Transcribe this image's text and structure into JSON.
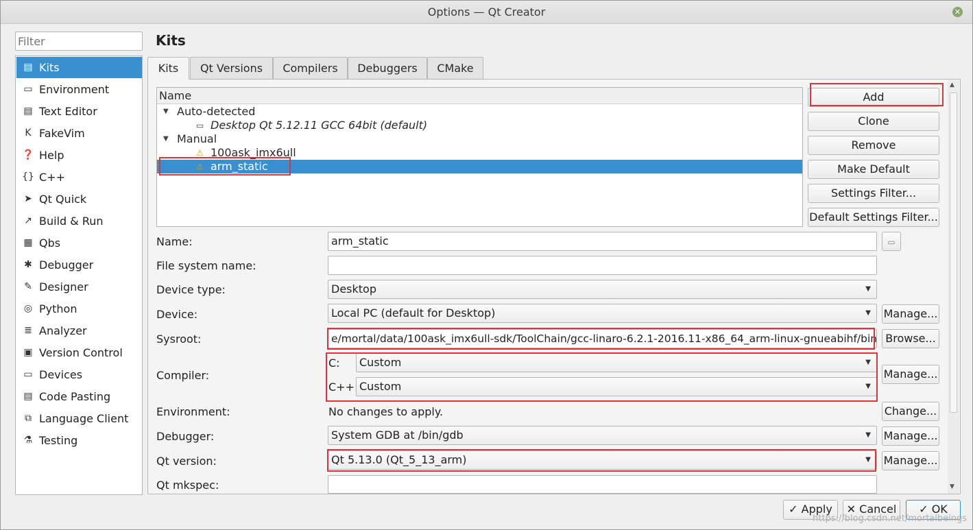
{
  "window": {
    "title": "Options — Qt Creator"
  },
  "filter": {
    "placeholder": "Filter"
  },
  "sidebar": {
    "items": [
      {
        "label": "Kits",
        "icon": "kits-icon",
        "glyph": "▤",
        "selected": true
      },
      {
        "label": "Environment",
        "icon": "environment-icon",
        "glyph": "▭"
      },
      {
        "label": "Text Editor",
        "icon": "text-editor-icon",
        "glyph": "▤"
      },
      {
        "label": "FakeVim",
        "icon": "fakevim-icon",
        "glyph": "K"
      },
      {
        "label": "Help",
        "icon": "help-icon",
        "glyph": "❓"
      },
      {
        "label": "C++",
        "icon": "cpp-icon",
        "glyph": "{}"
      },
      {
        "label": "Qt Quick",
        "icon": "qt-quick-icon",
        "glyph": "➤"
      },
      {
        "label": "Build & Run",
        "icon": "build-run-icon",
        "glyph": "↗"
      },
      {
        "label": "Qbs",
        "icon": "qbs-icon",
        "glyph": "▦"
      },
      {
        "label": "Debugger",
        "icon": "debugger-icon",
        "glyph": "✱"
      },
      {
        "label": "Designer",
        "icon": "designer-icon",
        "glyph": "✎"
      },
      {
        "label": "Python",
        "icon": "python-icon",
        "glyph": "◎"
      },
      {
        "label": "Analyzer",
        "icon": "analyzer-icon",
        "glyph": "≣"
      },
      {
        "label": "Version Control",
        "icon": "version-control-icon",
        "glyph": "▣"
      },
      {
        "label": "Devices",
        "icon": "devices-icon",
        "glyph": "▭"
      },
      {
        "label": "Code Pasting",
        "icon": "code-pasting-icon",
        "glyph": "▤"
      },
      {
        "label": "Language Client",
        "icon": "language-client-icon",
        "glyph": "⧉"
      },
      {
        "label": "Testing",
        "icon": "testing-icon",
        "glyph": "⚗"
      }
    ]
  },
  "page": {
    "title": "Kits"
  },
  "tabs": [
    {
      "label": "Kits",
      "active": true
    },
    {
      "label": "Qt Versions"
    },
    {
      "label": "Compilers"
    },
    {
      "label": "Debuggers"
    },
    {
      "label": "CMake"
    }
  ],
  "kit_tree": {
    "header": "Name",
    "groups": [
      {
        "label": "Auto-detected",
        "children": [
          {
            "label": "Desktop Qt 5.12.11 GCC 64bit (default)",
            "icon": "monitor-icon"
          }
        ]
      },
      {
        "label": "Manual",
        "children": [
          {
            "label": "100ask_imx6ull",
            "icon": "warning-icon"
          },
          {
            "label": "arm_static",
            "icon": "warning-icon",
            "selected": true
          }
        ]
      }
    ]
  },
  "buttons": {
    "add": "Add",
    "clone": "Clone",
    "remove": "Remove",
    "make_default": "Make Default",
    "settings_filter": "Settings Filter...",
    "default_settings_filter": "Default Settings Filter..."
  },
  "form": {
    "name": {
      "label": "Name:",
      "value": "arm_static"
    },
    "file_system_name": {
      "label": "File system name:",
      "value": ""
    },
    "device_type": {
      "label": "Device type:",
      "value": "Desktop"
    },
    "device": {
      "label": "Device:",
      "value": "Local PC (default for Desktop)",
      "button": "Manage..."
    },
    "sysroot": {
      "label": "Sysroot:",
      "value": "e/mortal/data/100ask_imx6ull-sdk/ToolChain/gcc-linaro-6.2.1-2016.11-x86_64_arm-linux-gnueabihf/bin",
      "button": "Browse..."
    },
    "compiler": {
      "label": "Compiler:",
      "c_label": "C:",
      "c_value": "Custom",
      "cpp_label": "C++:",
      "cpp_value": "Custom",
      "button": "Manage..."
    },
    "environment": {
      "label": "Environment:",
      "value": "No changes to apply.",
      "button": "Change..."
    },
    "debugger": {
      "label": "Debugger:",
      "value": "System GDB at /bin/gdb",
      "button": "Manage..."
    },
    "qt_version": {
      "label": "Qt version:",
      "value": "Qt 5.13.0 (Qt_5_13_arm)",
      "button": "Manage..."
    },
    "qt_mkspec": {
      "label": "Qt mkspec:",
      "value": ""
    }
  },
  "dialog_buttons": {
    "apply": "Apply",
    "cancel": "Cancel",
    "ok": "OK"
  },
  "watermark": "https://blog.csdn.net/mortalbeings",
  "colors": {
    "selection": "#3a8fcf",
    "highlight_box": "#d9353a",
    "warning": "#d9a400"
  }
}
